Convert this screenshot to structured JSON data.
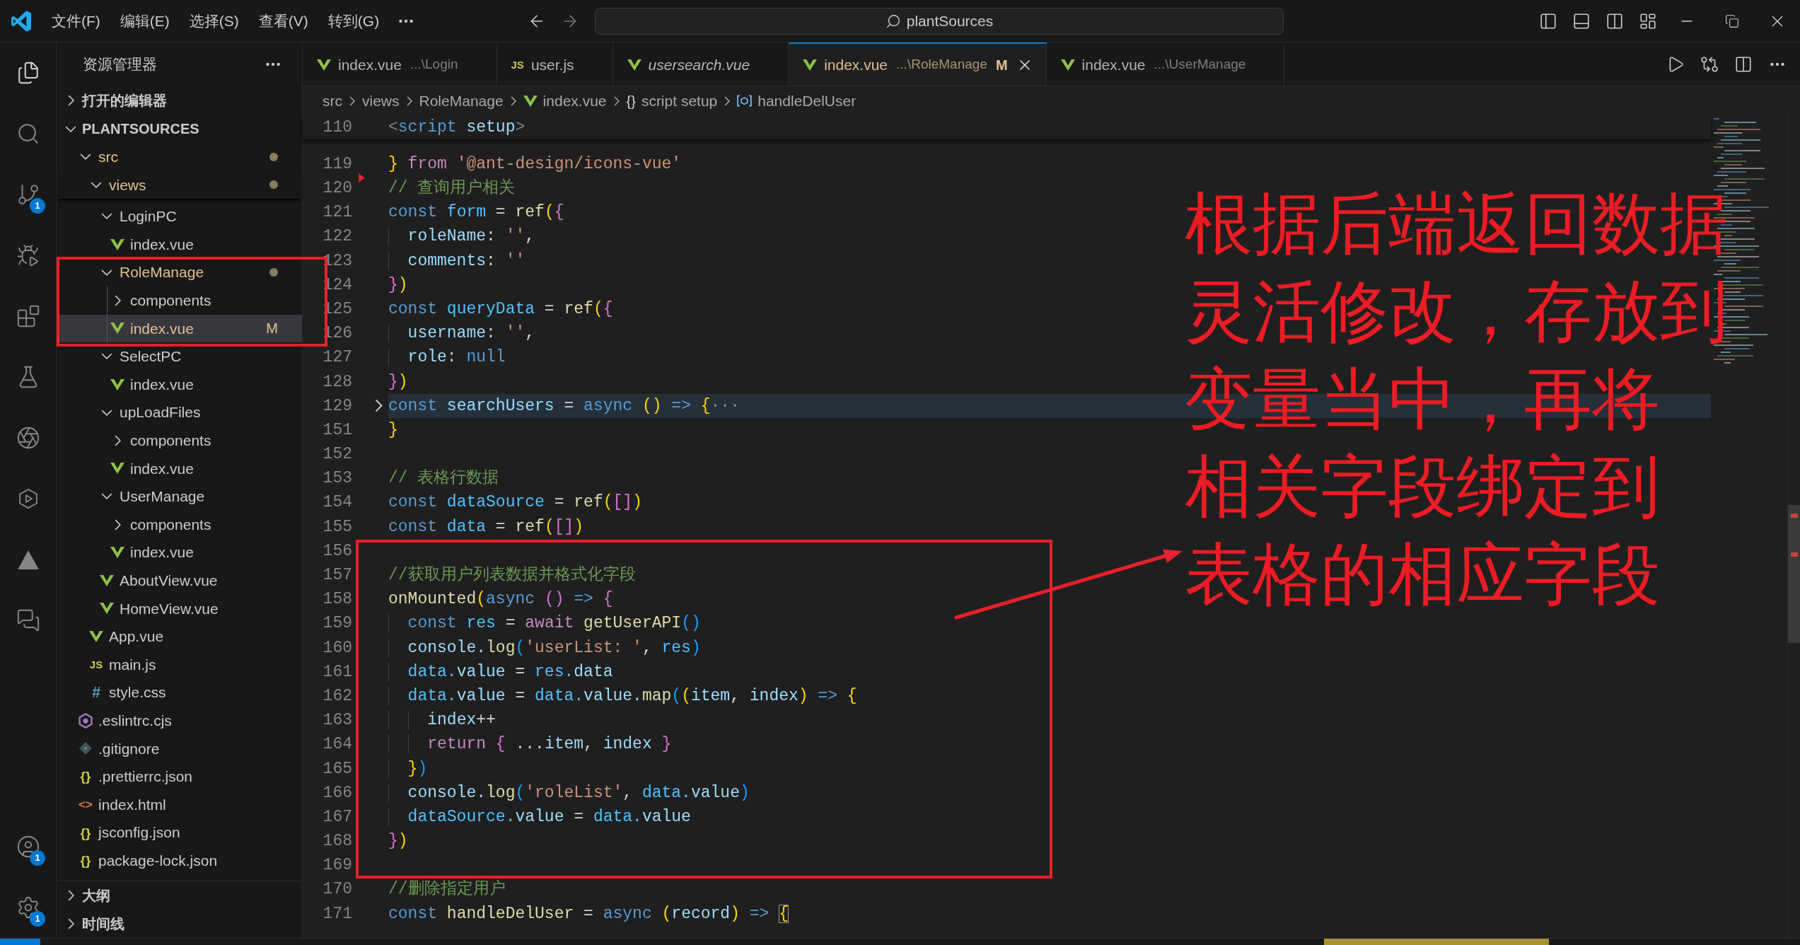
{
  "title_bar": {
    "menus": [
      "文件(F)",
      "编辑(E)",
      "选择(S)",
      "查看(V)",
      "转到(G)"
    ],
    "search": {
      "value": "plantSources"
    }
  },
  "activity_bar": {
    "top": [
      {
        "kind": "explorer",
        "selected": true
      },
      {
        "kind": "search",
        "selected": false
      },
      {
        "kind": "source_control",
        "selected": false,
        "badge": "1"
      },
      {
        "kind": "run_debug",
        "selected": false
      },
      {
        "kind": "extensions",
        "selected": false
      },
      {
        "kind": "testing",
        "selected": false
      },
      {
        "kind": "assistant",
        "selected": false
      },
      {
        "kind": "hexagon",
        "selected": false
      },
      {
        "kind": "triangle",
        "selected": false
      },
      {
        "kind": "chat",
        "selected": false
      }
    ],
    "bottom": [
      {
        "kind": "account",
        "badge": "1"
      },
      {
        "kind": "settings",
        "badge": "1"
      }
    ]
  },
  "sidebar": {
    "title": "资源管理器",
    "sections": [
      {
        "label": "打开的编辑器",
        "expanded": false
      },
      {
        "label": "PLANTSOURCES",
        "expanded": true
      }
    ],
    "tree": [
      {
        "name": "src",
        "kind": "folder",
        "expanded": true,
        "modified": true,
        "selected": false,
        "children": [
          {
            "name": "views",
            "kind": "folder",
            "expanded": true,
            "modified": true,
            "selected": false,
            "children": [
              {
                "name": "LoginPC",
                "kind": "folder",
                "expanded": true,
                "modified": false,
                "selected": false,
                "children": [
                  {
                    "name": "index.vue",
                    "kind": "vue",
                    "modified": false,
                    "selected": false
                  }
                ]
              },
              {
                "name": "RoleManage",
                "kind": "folder",
                "expanded": true,
                "modified": true,
                "selected": false,
                "children": [
                  {
                    "name": "components",
                    "kind": "folder",
                    "expanded": false,
                    "modified": false,
                    "selected": false
                  },
                  {
                    "name": "index.vue",
                    "kind": "vue",
                    "modified": true,
                    "git_status": "M",
                    "selected": true
                  }
                ]
              },
              {
                "name": "SelectPC",
                "kind": "folder",
                "expanded": true,
                "modified": false,
                "selected": false,
                "children": [
                  {
                    "name": "index.vue",
                    "kind": "vue",
                    "modified": false,
                    "selected": false
                  }
                ]
              },
              {
                "name": "upLoadFiles",
                "kind": "folder",
                "expanded": true,
                "modified": false,
                "selected": false,
                "children": [
                  {
                    "name": "components",
                    "kind": "folder",
                    "expanded": false,
                    "modified": false,
                    "selected": false
                  },
                  {
                    "name": "index.vue",
                    "kind": "vue",
                    "modified": false,
                    "selected": false
                  }
                ]
              },
              {
                "name": "UserManage",
                "kind": "folder",
                "expanded": true,
                "modified": false,
                "selected": false,
                "children": [
                  {
                    "name": "components",
                    "kind": "folder",
                    "expanded": false,
                    "modified": false,
                    "selected": false
                  },
                  {
                    "name": "index.vue",
                    "kind": "vue",
                    "modified": false,
                    "selected": false
                  }
                ]
              },
              {
                "name": "AboutView.vue",
                "kind": "vue",
                "modified": false,
                "selected": false
              },
              {
                "name": "HomeView.vue",
                "kind": "vue",
                "modified": false,
                "selected": false
              }
            ]
          },
          {
            "name": "App.vue",
            "kind": "vue",
            "modified": false,
            "selected": false
          },
          {
            "name": "main.js",
            "kind": "js",
            "glyph": "JS",
            "modified": false,
            "selected": false
          },
          {
            "name": "style.css",
            "kind": "css",
            "glyph": "#",
            "modified": false,
            "selected": false
          }
        ]
      },
      {
        "name": ".eslintrc.cjs",
        "kind": "eslint",
        "modified": false,
        "selected": false
      },
      {
        "name": ".gitignore",
        "kind": "git",
        "modified": false,
        "selected": false
      },
      {
        "name": ".prettierrc.json",
        "kind": "json",
        "glyph": "{}",
        "modified": false,
        "selected": false
      },
      {
        "name": "index.html",
        "kind": "html",
        "glyph": "<>",
        "modified": false,
        "selected": false
      },
      {
        "name": "jsconfig.json",
        "kind": "json",
        "glyph": "{}",
        "modified": false,
        "selected": false
      },
      {
        "name": "package-lock.json",
        "kind": "json",
        "glyph": "{}",
        "modified": false,
        "selected": false
      }
    ],
    "footer_sections": [
      {
        "label": "大纲",
        "expanded": false
      },
      {
        "label": "时间线",
        "expanded": false
      }
    ]
  },
  "tabs": [
    {
      "name": "index.vue",
      "path": "...\\Login",
      "kind": "vue",
      "selected": false,
      "preview": false,
      "modified": false
    },
    {
      "name": "user.js",
      "kind": "js",
      "glyph": "JS",
      "selected": false,
      "preview": false,
      "modified": false
    },
    {
      "name": "usersearch.vue",
      "kind": "vue",
      "selected": false,
      "preview": true,
      "modified": false
    },
    {
      "name": "index.vue",
      "path": "...\\RoleManage",
      "kind": "vue",
      "selected": true,
      "preview": false,
      "modified": true,
      "git_status": "M"
    },
    {
      "name": "index.vue",
      "path": "...\\UserManage",
      "kind": "vue",
      "selected": false,
      "preview": false,
      "modified": false
    }
  ],
  "breadcrumb": [
    {
      "label": "src",
      "kind": "folder"
    },
    {
      "label": "views",
      "kind": "folder"
    },
    {
      "label": "RoleManage",
      "kind": "folder"
    },
    {
      "label": "index.vue",
      "kind": "vue"
    },
    {
      "label": "script setup",
      "kind": "module",
      "glyph": "{}"
    },
    {
      "label": "handleDelUser",
      "kind": "variable"
    }
  ],
  "editor": {
    "sticky_line": {
      "number": "110",
      "tokens": [
        {
          "text": "<",
          "kind": "tag"
        },
        {
          "text": "script",
          "kind": "tagname"
        },
        {
          "text": " setup",
          "kind": "attr"
        },
        {
          "text": ">",
          "kind": "tag"
        }
      ]
    },
    "lines": [
      {
        "number": "119",
        "folded": false,
        "git_deleted": false,
        "tokens": [
          {
            "text": "}",
            "kind": "b1"
          },
          {
            "text": " from ",
            "kind": "ctrl"
          },
          {
            "text": "'@ant-design/icons-vue'",
            "kind": "str"
          }
        ]
      },
      {
        "number": "120",
        "folded": false,
        "git_deleted": true,
        "tokens": [
          {
            "text": "// 查询用户相关",
            "kind": "cmt"
          }
        ]
      },
      {
        "number": "121",
        "folded": false,
        "git_deleted": false,
        "tokens": [
          {
            "text": "const ",
            "kind": "kw"
          },
          {
            "text": "form",
            "kind": "cst"
          },
          {
            "text": " = ",
            "kind": "p"
          },
          {
            "text": "ref",
            "kind": "fn"
          },
          {
            "text": "(",
            "kind": "b1"
          },
          {
            "text": "{",
            "kind": "b2"
          }
        ]
      },
      {
        "number": "122",
        "folded": false,
        "git_deleted": false,
        "tokens": [
          {
            "text": "  roleName",
            "kind": "var"
          },
          {
            "text": ": ",
            "kind": "p"
          },
          {
            "text": "''",
            "kind": "str"
          },
          {
            "text": ",",
            "kind": "p"
          }
        ]
      },
      {
        "number": "123",
        "folded": false,
        "git_deleted": false,
        "tokens": [
          {
            "text": "  comments",
            "kind": "var"
          },
          {
            "text": ": ",
            "kind": "p"
          },
          {
            "text": "''",
            "kind": "str"
          }
        ]
      },
      {
        "number": "124",
        "folded": false,
        "git_deleted": false,
        "tokens": [
          {
            "text": "}",
            "kind": "b2"
          },
          {
            "text": ")",
            "kind": "b1"
          }
        ]
      },
      {
        "number": "125",
        "folded": false,
        "git_deleted": false,
        "tokens": [
          {
            "text": "const ",
            "kind": "kw"
          },
          {
            "text": "queryData",
            "kind": "cst"
          },
          {
            "text": " = ",
            "kind": "p"
          },
          {
            "text": "ref",
            "kind": "fn"
          },
          {
            "text": "(",
            "kind": "b1"
          },
          {
            "text": "{",
            "kind": "b2"
          }
        ]
      },
      {
        "number": "126",
        "folded": false,
        "git_deleted": false,
        "tokens": [
          {
            "text": "  username",
            "kind": "var"
          },
          {
            "text": ": ",
            "kind": "p"
          },
          {
            "text": "''",
            "kind": "str"
          },
          {
            "text": ",",
            "kind": "p"
          }
        ]
      },
      {
        "number": "127",
        "folded": false,
        "git_deleted": false,
        "tokens": [
          {
            "text": "  role",
            "kind": "var"
          },
          {
            "text": ": ",
            "kind": "p"
          },
          {
            "text": "null",
            "kind": "kw"
          }
        ]
      },
      {
        "number": "128",
        "folded": false,
        "git_deleted": false,
        "tokens": [
          {
            "text": "}",
            "kind": "b2"
          },
          {
            "text": ")",
            "kind": "b1"
          }
        ]
      },
      {
        "number": "129",
        "folded": true,
        "git_deleted": false,
        "tokens": [
          {
            "text": "const ",
            "kind": "kw"
          },
          {
            "text": "searchUsers",
            "kind": "var"
          },
          {
            "text": " = ",
            "kind": "p"
          },
          {
            "text": "async ",
            "kind": "kw"
          },
          {
            "text": "()",
            "kind": "b1"
          },
          {
            "text": " => ",
            "kind": "kw"
          },
          {
            "text": "{",
            "kind": "b1"
          },
          {
            "text": "···",
            "kind": "fold"
          }
        ]
      },
      {
        "number": "151",
        "folded": false,
        "git_deleted": false,
        "tokens": [
          {
            "text": "}",
            "kind": "b1"
          }
        ]
      },
      {
        "number": "152",
        "folded": false,
        "git_deleted": false
      },
      {
        "number": "153",
        "folded": false,
        "git_deleted": false,
        "tokens": [
          {
            "text": "// 表格行数据",
            "kind": "cmt"
          }
        ]
      },
      {
        "number": "154",
        "folded": false,
        "git_deleted": false,
        "tokens": [
          {
            "text": "const ",
            "kind": "kw"
          },
          {
            "text": "dataSource",
            "kind": "cst"
          },
          {
            "text": " = ",
            "kind": "p"
          },
          {
            "text": "ref",
            "kind": "fn"
          },
          {
            "text": "(",
            "kind": "b1"
          },
          {
            "text": "[]",
            "kind": "b2"
          },
          {
            "text": ")",
            "kind": "b1"
          }
        ]
      },
      {
        "number": "155",
        "folded": false,
        "git_deleted": false,
        "tokens": [
          {
            "text": "const ",
            "kind": "kw"
          },
          {
            "text": "data",
            "kind": "cst"
          },
          {
            "text": " = ",
            "kind": "p"
          },
          {
            "text": "ref",
            "kind": "fn"
          },
          {
            "text": "(",
            "kind": "b1"
          },
          {
            "text": "[]",
            "kind": "b2"
          },
          {
            "text": ")",
            "kind": "b1"
          }
        ]
      },
      {
        "number": "156",
        "folded": false,
        "git_deleted": false
      },
      {
        "number": "157",
        "folded": false,
        "git_deleted": false,
        "tokens": [
          {
            "text": "//获取用户列表数据并格式化字段",
            "kind": "cmt"
          }
        ]
      },
      {
        "number": "158",
        "folded": false,
        "git_deleted": false,
        "tokens": [
          {
            "text": "onMounted",
            "kind": "fn"
          },
          {
            "text": "(",
            "kind": "b1"
          },
          {
            "text": "async ",
            "kind": "kw"
          },
          {
            "text": "()",
            "kind": "b2"
          },
          {
            "text": " => ",
            "kind": "kw"
          },
          {
            "text": "{",
            "kind": "b2"
          }
        ]
      },
      {
        "number": "159",
        "folded": false,
        "git_deleted": false,
        "tokens": [
          {
            "text": "  const ",
            "kind": "kw"
          },
          {
            "text": "res",
            "kind": "cst"
          },
          {
            "text": " = ",
            "kind": "p"
          },
          {
            "text": "await ",
            "kind": "ctrl"
          },
          {
            "text": "getUserAPI",
            "kind": "fn"
          },
          {
            "text": "()",
            "kind": "b3"
          }
        ]
      },
      {
        "number": "160",
        "folded": false,
        "git_deleted": false,
        "tokens": [
          {
            "text": "  console.",
            "kind": "var"
          },
          {
            "text": "log",
            "kind": "fn"
          },
          {
            "text": "(",
            "kind": "b3"
          },
          {
            "text": "'userList: '",
            "kind": "str"
          },
          {
            "text": ", ",
            "kind": "p"
          },
          {
            "text": "res",
            "kind": "cst"
          },
          {
            "text": ")",
            "kind": "b3"
          }
        ]
      },
      {
        "number": "161",
        "folded": false,
        "git_deleted": false,
        "tokens": [
          {
            "text": "  data.",
            "kind": "cst"
          },
          {
            "text": "value",
            "kind": "var"
          },
          {
            "text": " = ",
            "kind": "p"
          },
          {
            "text": "res.",
            "kind": "cst"
          },
          {
            "text": "data",
            "kind": "var"
          }
        ]
      },
      {
        "number": "162",
        "folded": false,
        "git_deleted": false,
        "tokens": [
          {
            "text": "  data.",
            "kind": "cst"
          },
          {
            "text": "value",
            "kind": "var"
          },
          {
            "text": " = ",
            "kind": "p"
          },
          {
            "text": "data.",
            "kind": "cst"
          },
          {
            "text": "value.",
            "kind": "var"
          },
          {
            "text": "map",
            "kind": "fn"
          },
          {
            "text": "(",
            "kind": "b3"
          },
          {
            "text": "(",
            "kind": "b1"
          },
          {
            "text": "item",
            "kind": "var"
          },
          {
            "text": ", ",
            "kind": "p"
          },
          {
            "text": "index",
            "kind": "var"
          },
          {
            "text": ")",
            "kind": "b1"
          },
          {
            "text": " => ",
            "kind": "kw"
          },
          {
            "text": "{",
            "kind": "b1"
          }
        ]
      },
      {
        "number": "163",
        "folded": false,
        "git_deleted": false,
        "tokens": [
          {
            "text": "    index",
            "kind": "var"
          },
          {
            "text": "++",
            "kind": "p"
          }
        ]
      },
      {
        "number": "164",
        "folded": false,
        "git_deleted": false,
        "tokens": [
          {
            "text": "    return ",
            "kind": "ctrl"
          },
          {
            "text": "{",
            "kind": "b2"
          },
          {
            "text": " ...",
            "kind": "p"
          },
          {
            "text": "item",
            "kind": "var"
          },
          {
            "text": ", ",
            "kind": "p"
          },
          {
            "text": "index",
            "kind": "var"
          },
          {
            "text": " }",
            "kind": "b2"
          }
        ]
      },
      {
        "number": "165",
        "folded": false,
        "git_deleted": false,
        "tokens": [
          {
            "text": "  }",
            "kind": "b1"
          },
          {
            "text": ")",
            "kind": "b3"
          }
        ]
      },
      {
        "number": "166",
        "folded": false,
        "git_deleted": false,
        "tokens": [
          {
            "text": "  console.",
            "kind": "var"
          },
          {
            "text": "log",
            "kind": "fn"
          },
          {
            "text": "(",
            "kind": "b3"
          },
          {
            "text": "'roleList'",
            "kind": "str"
          },
          {
            "text": ", ",
            "kind": "p"
          },
          {
            "text": "data.",
            "kind": "cst"
          },
          {
            "text": "value",
            "kind": "var"
          },
          {
            "text": ")",
            "kind": "b3"
          }
        ]
      },
      {
        "number": "167",
        "folded": false,
        "git_deleted": false,
        "tokens": [
          {
            "text": "  dataSource.",
            "kind": "cst"
          },
          {
            "text": "value",
            "kind": "var"
          },
          {
            "text": " = ",
            "kind": "p"
          },
          {
            "text": "data.",
            "kind": "cst"
          },
          {
            "text": "value",
            "kind": "var"
          }
        ]
      },
      {
        "number": "168",
        "folded": false,
        "git_deleted": false,
        "tokens": [
          {
            "text": "}",
            "kind": "b2"
          },
          {
            "text": ")",
            "kind": "b1"
          }
        ]
      },
      {
        "number": "169",
        "folded": false,
        "git_deleted": false
      },
      {
        "number": "170",
        "folded": false,
        "git_deleted": false,
        "tokens": [
          {
            "text": "//删除指定用户",
            "kind": "cmt"
          }
        ]
      },
      {
        "number": "171",
        "folded": false,
        "git_deleted": false,
        "tokens": [
          {
            "text": "const ",
            "kind": "kw"
          },
          {
            "text": "handleDelUser",
            "kind": "fn"
          },
          {
            "text": " = ",
            "kind": "p"
          },
          {
            "text": "async ",
            "kind": "kw"
          },
          {
            "text": "(",
            "kind": "b1"
          },
          {
            "text": "record",
            "kind": "var"
          },
          {
            "text": ")",
            "kind": "b1"
          },
          {
            "text": " => ",
            "kind": "kw"
          },
          {
            "text": "{",
            "kind": "b1",
            "matched": true
          }
        ]
      }
    ]
  },
  "annotation": {
    "lines": [
      "根据后端返回数据",
      "灵活修改，存放到",
      "变量当中，再将",
      "相关字段绑定到",
      "表格的相应字段"
    ]
  }
}
